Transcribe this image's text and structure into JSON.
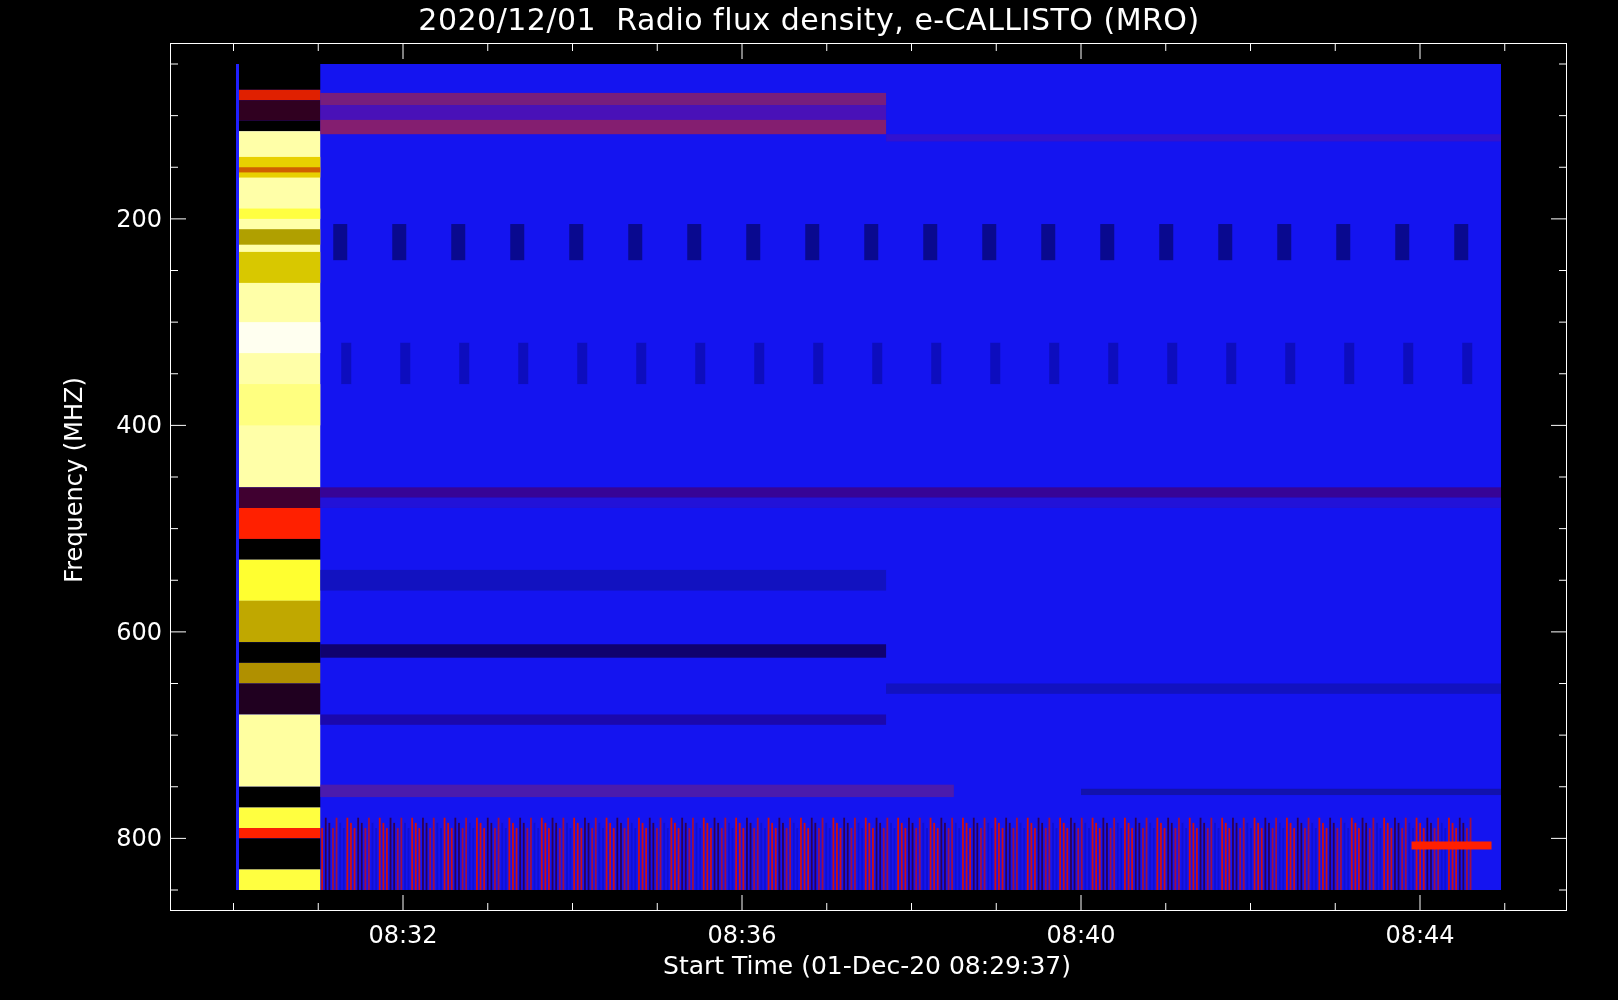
{
  "title": "2020/12/01  Radio flux density, e-CALLISTO (MRO)",
  "y_axis": {
    "label": "Frequency (MHZ)",
    "ticks": [
      "200",
      "400",
      "600",
      "800"
    ]
  },
  "x_axis": {
    "label": "Start Time (01-Dec-20 08:29:37)",
    "ticks": [
      "08:32",
      "08:36",
      "08:40",
      "08:44"
    ]
  }
}
